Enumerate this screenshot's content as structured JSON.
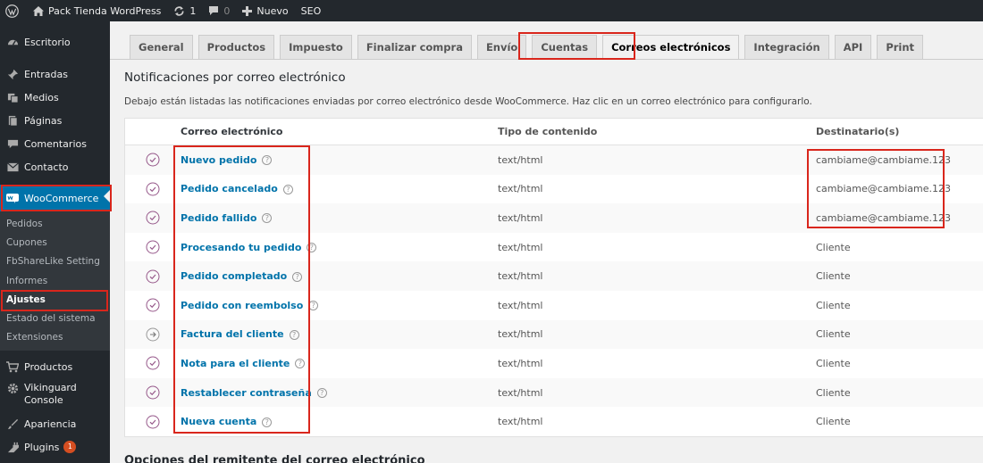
{
  "adminbar": {
    "site_name": "Pack Tienda WordPress",
    "updates_count": "1",
    "comments_count": "0",
    "new_label": "Nuevo",
    "seo_label": "SEO"
  },
  "sidebar": {
    "items_top": [
      {
        "label": "Escritorio",
        "icon": "dashboard-icon"
      },
      {
        "label": "Entradas",
        "icon": "pin-icon"
      },
      {
        "label": "Medios",
        "icon": "media-icon"
      },
      {
        "label": "Páginas",
        "icon": "pages-icon"
      },
      {
        "label": "Comentarios",
        "icon": "comments-icon"
      },
      {
        "label": "Contacto",
        "icon": "mail-icon"
      }
    ],
    "woocommerce_label": "WooCommerce",
    "submenu": [
      "Pedidos",
      "Cupones",
      "FbShareLike Setting",
      "Informes",
      "Ajustes",
      "Estado del sistema",
      "Extensiones"
    ],
    "items_bottom": [
      {
        "label": "Productos",
        "icon": "cart-icon"
      },
      {
        "label": "Vikinguard",
        "label2": "Console",
        "icon": "gear-icon"
      },
      {
        "label": "Apariencia",
        "icon": "brush-icon"
      },
      {
        "label": "Plugins",
        "icon": "plugin-icon",
        "badge": "1"
      }
    ]
  },
  "tabs": [
    "General",
    "Productos",
    "Impuesto",
    "Finalizar compra",
    "Envío",
    "Cuentas",
    "Correos electrónicos",
    "Integración",
    "API",
    "Print"
  ],
  "active_tab": "Correos electrónicos",
  "section_title": "Notificaciones por correo electrónico",
  "description": "Debajo están listadas las notificaciones enviadas por correo electrónico desde WooCommerce. Haz clic en un correo electrónico para configurarlo.",
  "table": {
    "headers": {
      "email": "Correo electrónico",
      "type": "Tipo de contenido",
      "recipient": "Destinatario(s)"
    },
    "rows": [
      {
        "email": "Nuevo pedido",
        "type": "text/html",
        "recipient": "cambiame@cambiame.123",
        "status": "enabled"
      },
      {
        "email": "Pedido cancelado",
        "type": "text/html",
        "recipient": "cambiame@cambiame.123",
        "status": "enabled"
      },
      {
        "email": "Pedido fallido",
        "type": "text/html",
        "recipient": "cambiame@cambiame.123",
        "status": "enabled"
      },
      {
        "email": "Procesando tu pedido",
        "type": "text/html",
        "recipient": "Cliente",
        "status": "enabled"
      },
      {
        "email": "Pedido completado",
        "type": "text/html",
        "recipient": "Cliente",
        "status": "enabled"
      },
      {
        "email": "Pedido con reembolso",
        "type": "text/html",
        "recipient": "Cliente",
        "status": "enabled"
      },
      {
        "email": "Factura del cliente",
        "type": "text/html",
        "recipient": "Cliente",
        "status": "manual"
      },
      {
        "email": "Nota para el cliente",
        "type": "text/html",
        "recipient": "Cliente",
        "status": "enabled"
      },
      {
        "email": "Restablecer contraseña",
        "type": "text/html",
        "recipient": "Cliente",
        "status": "enabled"
      },
      {
        "email": "Nueva cuenta",
        "type": "text/html",
        "recipient": "Cliente",
        "status": "enabled"
      }
    ]
  },
  "section2_title": "Opciones del remitente del correo electrónico",
  "colors": {
    "adminbar": "#23282d",
    "accent": "#0073aa",
    "highlight": "#d9261c",
    "status": "#96588a"
  }
}
